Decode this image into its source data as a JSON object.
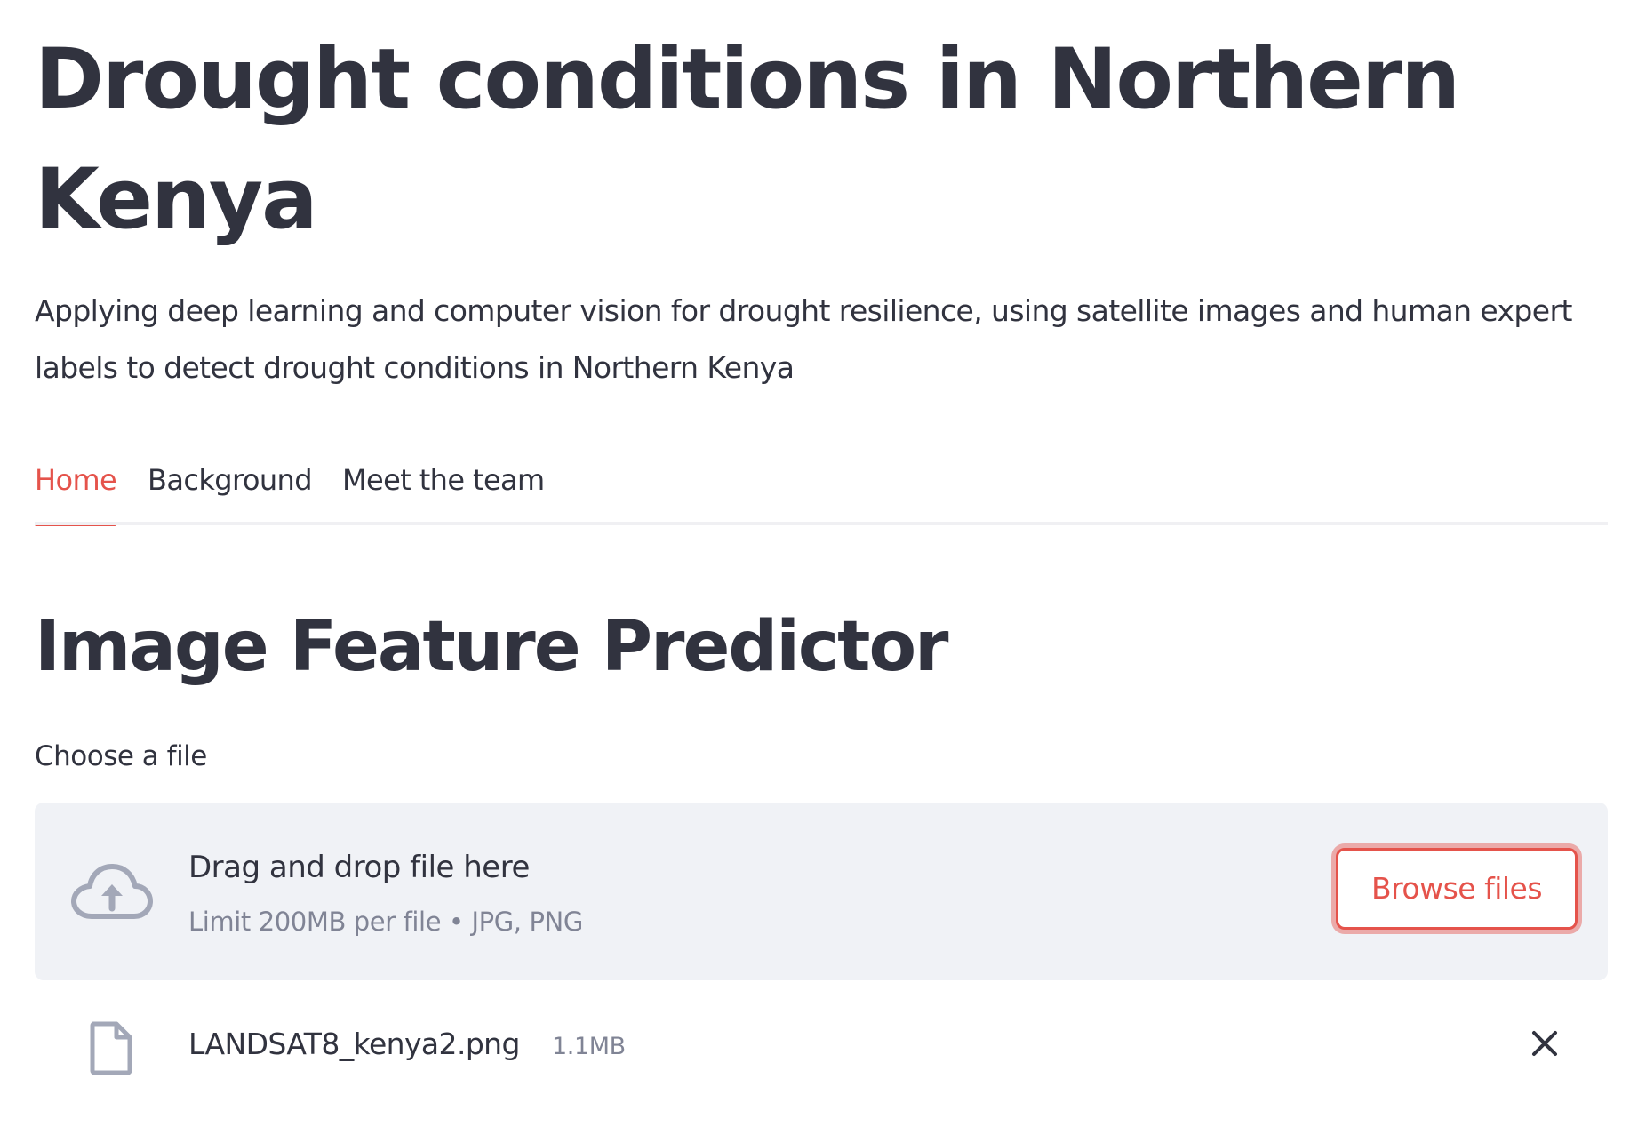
{
  "header": {
    "title": "Drought conditions in Northern Kenya",
    "subtitle": "Applying deep learning and computer vision for drought resilience, using satellite images and human expert labels to detect drought conditions in Northern Kenya"
  },
  "tabs": [
    {
      "label": "Home",
      "active": true
    },
    {
      "label": "Background",
      "active": false
    },
    {
      "label": "Meet the team",
      "active": false
    }
  ],
  "main": {
    "section_title": "Image Feature Predictor",
    "uploader": {
      "label": "Choose a file",
      "drop_title": "Drag and drop file here",
      "drop_hint": "Limit 200MB per file • JPG, PNG",
      "browse_label": "Browse files",
      "icon": "cloud-upload-icon"
    },
    "uploaded_file": {
      "name": "LANDSAT8_kenya2.png",
      "size": "1.1MB",
      "icon": "file-icon",
      "remove_icon": "close-icon"
    }
  },
  "colors": {
    "accent": "#e5534b",
    "text": "#31333f",
    "muted_text": "#808495",
    "dropzone_bg": "#f0f2f6",
    "icon": "#a3a8b8"
  }
}
